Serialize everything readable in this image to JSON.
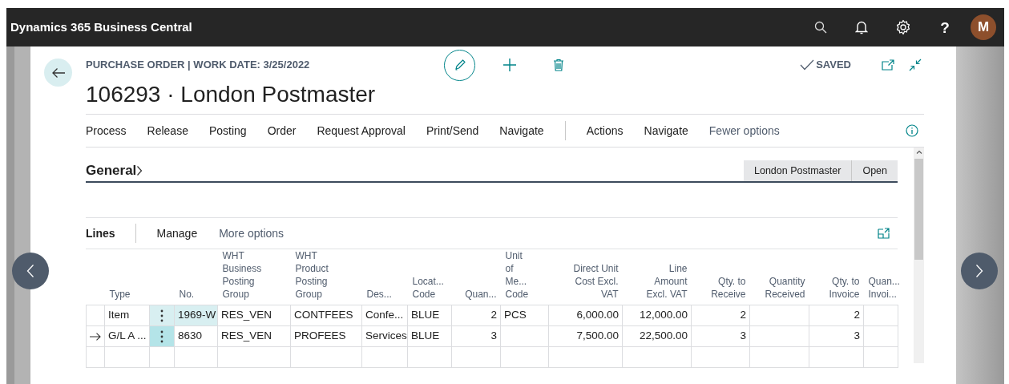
{
  "app_bar": {
    "title": "Dynamics 365 Business Central",
    "help": "?",
    "avatar": "M"
  },
  "page": {
    "caption": "PURCHASE ORDER | WORK DATE: 3/25/2022",
    "title": "106293 · London Postmaster",
    "status": "SAVED"
  },
  "action_bar": {
    "primary": [
      "Process",
      "Release",
      "Posting",
      "Order",
      "Request Approval",
      "Print/Send",
      "Navigate"
    ],
    "secondary": [
      "Actions",
      "Navigate"
    ],
    "fewer_options": "Fewer options"
  },
  "general": {
    "title": "General",
    "facts": [
      "London Postmaster",
      "Open"
    ]
  },
  "lines": {
    "title": "Lines",
    "actions": [
      "Manage"
    ],
    "more_options": "More options",
    "columns": [
      {
        "kind": "indicator"
      },
      {
        "kind": "text",
        "header": "Type"
      },
      {
        "kind": "menu"
      },
      {
        "kind": "text",
        "header": "No."
      },
      {
        "kind": "text",
        "header": "WHT\nBusiness\nPosting\nGroup"
      },
      {
        "kind": "text",
        "header": "WHT\nProduct\nPosting\nGroup"
      },
      {
        "kind": "text",
        "header": "Des..."
      },
      {
        "kind": "text",
        "header": "Locat...\nCode"
      },
      {
        "kind": "number",
        "header": "Quan..."
      },
      {
        "kind": "text",
        "header": "Unit\nof\nMe...\nCode"
      },
      {
        "kind": "number",
        "header": "Direct Unit\nCost Excl.\nVAT"
      },
      {
        "kind": "number",
        "header": "Line\nAmount\nExcl. VAT"
      },
      {
        "kind": "number",
        "header": "Qty. to\nReceive"
      },
      {
        "kind": "number",
        "header": "Quantity\nReceived"
      },
      {
        "kind": "number",
        "header": "Qty. to\nInvoice"
      },
      {
        "kind": "text",
        "header": "Quan...\nInvoi..."
      }
    ],
    "rows": [
      {
        "selected": false,
        "focused": true,
        "cells": [
          null,
          "Item",
          null,
          "1969-W",
          "RES_VEN",
          "CONTFEES",
          "Confe...",
          "BLUE",
          "2",
          "PCS",
          "6,000.00",
          "12,000.00",
          "2",
          null,
          "2",
          null
        ]
      },
      {
        "selected": true,
        "focused": false,
        "cells": [
          null,
          "G/L A ...",
          null,
          "8630",
          "RES_VEN",
          "PROFEES",
          "Services",
          "BLUE",
          "3",
          null,
          "7,500.00",
          "22,500.00",
          "3",
          null,
          "3",
          null
        ]
      }
    ]
  }
}
